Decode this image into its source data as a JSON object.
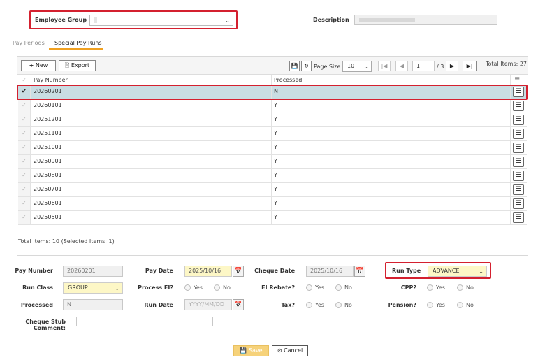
{
  "header": {
    "employee_group_label": "Employee Group",
    "employee_group_value": "",
    "description_label": "Description",
    "description_value": ""
  },
  "tabs": [
    {
      "label": "Pay Periods",
      "active": false
    },
    {
      "label": "Special Pay Runs",
      "active": true
    }
  ],
  "toolbar": {
    "new_label": "New",
    "export_label": "Export",
    "page_size_label": "Page Size:",
    "page_size_value": "10",
    "current_page": "1",
    "total_pages": "/ 3",
    "total_items": "Total Items: 27"
  },
  "grid": {
    "columns": [
      "Pay Number",
      "Processed"
    ],
    "rows": [
      {
        "pay_number": "20260201",
        "processed": "N",
        "selected": true
      },
      {
        "pay_number": "20260101",
        "processed": "Y",
        "selected": false
      },
      {
        "pay_number": "20251201",
        "processed": "Y",
        "selected": false
      },
      {
        "pay_number": "20251101",
        "processed": "Y",
        "selected": false
      },
      {
        "pay_number": "20251001",
        "processed": "Y",
        "selected": false
      },
      {
        "pay_number": "20250901",
        "processed": "Y",
        "selected": false
      },
      {
        "pay_number": "20250801",
        "processed": "Y",
        "selected": false
      },
      {
        "pay_number": "20250701",
        "processed": "Y",
        "selected": false
      },
      {
        "pay_number": "20250601",
        "processed": "Y",
        "selected": false
      },
      {
        "pay_number": "20250501",
        "processed": "Y",
        "selected": false
      }
    ],
    "footer": "Total Items: 10 (Selected Items: 1)"
  },
  "form": {
    "pay_number_label": "Pay Number",
    "pay_number_value": "20260201",
    "pay_date_label": "Pay Date",
    "pay_date_value": "2025/10/16",
    "cheque_date_label": "Cheque Date",
    "cheque_date_value": "2025/10/16",
    "run_type_label": "Run Type",
    "run_type_value": "ADVANCE",
    "run_class_label": "Run Class",
    "run_class_value": "GROUP",
    "process_ei_label": "Process EI?",
    "ei_rebate_label": "EI Rebate?",
    "cpp_label": "CPP?",
    "processed_label": "Processed",
    "processed_value": "N",
    "run_date_label": "Run Date",
    "run_date_placeholder": "YYYY/MM/DD",
    "tax_label": "Tax?",
    "pension_label": "Pension?",
    "yes_label": "Yes",
    "no_label": "No",
    "cheque_stub_label_line1": "Cheque Stub",
    "cheque_stub_label_line2": "Comment:",
    "cheque_stub_value": ""
  },
  "actions": {
    "save_label": "Save",
    "cancel_label": "Cancel"
  },
  "colors": {
    "highlight_red": "#d4202f",
    "tab_underline": "#f0a020",
    "selected_row": "#c9dde3",
    "yellow_field": "#fdf7c6",
    "save_button": "#f6d27a"
  }
}
